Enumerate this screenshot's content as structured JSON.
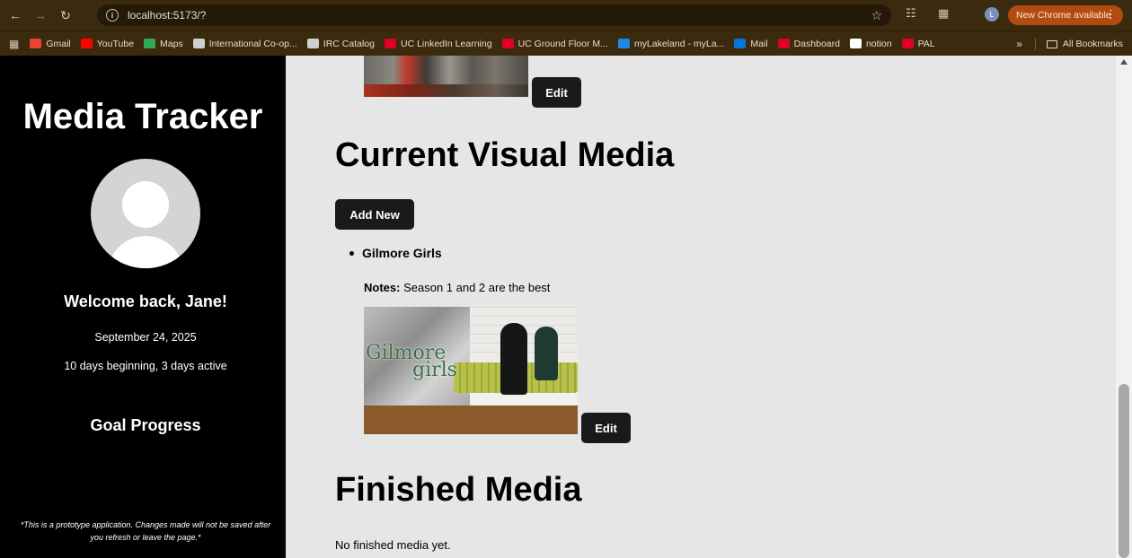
{
  "browser": {
    "url": "localhost:5173/?",
    "update_label": "New Chrome available",
    "profile_initial": "L",
    "bookmarks": [
      {
        "label": "Gmail",
        "color": "#ea4335"
      },
      {
        "label": "YouTube",
        "color": "#ff0000"
      },
      {
        "label": "Maps",
        "color": "#34a853"
      },
      {
        "label": "International Co-op...",
        "color": "#cfcfcf"
      },
      {
        "label": "IRC Catalog",
        "color": "#cfcfcf"
      },
      {
        "label": "UC LinkedIn Learning",
        "color": "#e00122"
      },
      {
        "label": "UC Ground Floor M...",
        "color": "#e00122"
      },
      {
        "label": "myLakeland - myLa...",
        "color": "#1e88e5"
      },
      {
        "label": "Mail",
        "color": "#0078d4"
      },
      {
        "label": "Dashboard",
        "color": "#e00122"
      },
      {
        "label": "notion",
        "color": "#ffffff"
      },
      {
        "label": "PAL",
        "color": "#e00122"
      }
    ],
    "all_bookmarks_label": "All Bookmarks"
  },
  "sidebar": {
    "app_title": "Media Tracker",
    "welcome": "Welcome back, Jane!",
    "date": "September 24, 2025",
    "streak": "10 days beginning, 3 days active",
    "goal_heading": "Goal Progress",
    "disclaimer": "*This is a prototype application. Changes made will not be saved after you refresh or leave the page.*"
  },
  "main": {
    "edit_label": "Edit",
    "current_title": "Current Visual Media",
    "add_new_label": "Add New",
    "current_items": [
      {
        "title": "Gilmore Girls",
        "notes_label": "Notes:",
        "notes": "Season 1 and 2 are the best",
        "poster_logo_line1": "Gilmore",
        "poster_logo_line2": "girls"
      }
    ],
    "finished_title": "Finished Media",
    "finished_empty": "No finished media yet."
  }
}
